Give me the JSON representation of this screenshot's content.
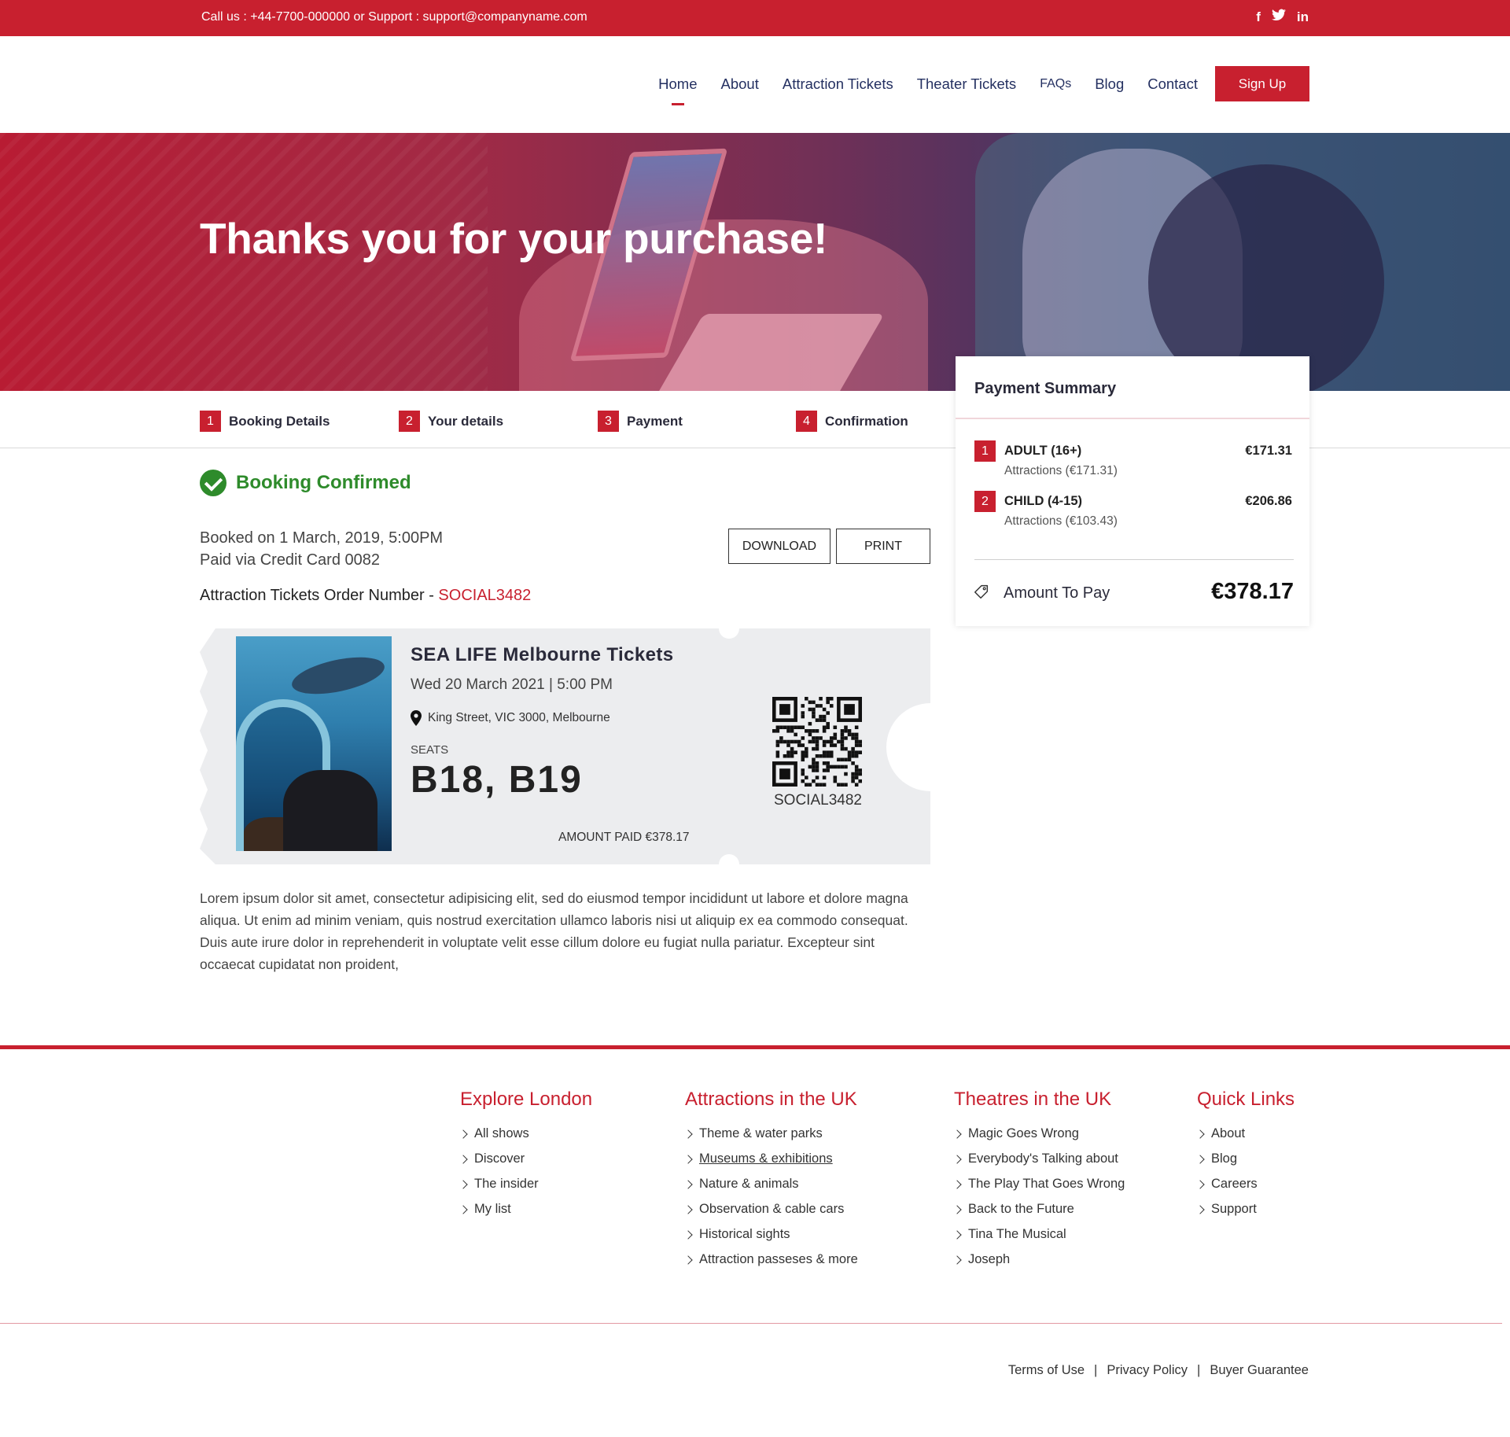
{
  "topbar": {
    "contact": "Call us : +44-7700-000000  or  Support : support@companyname.com",
    "social": [
      {
        "icon": "facebook-icon",
        "glyph": "f"
      },
      {
        "icon": "twitter-icon",
        "glyph": "🐦"
      },
      {
        "icon": "linkedin-icon",
        "glyph": "in"
      }
    ]
  },
  "nav": {
    "items": [
      "Home",
      "About",
      "Attraction Tickets",
      "Theater Tickets",
      "FAQs",
      "Blog",
      "Contact"
    ],
    "active": "Home",
    "signup": "Sign Up"
  },
  "hero": {
    "title": "Thanks you for your purchase!"
  },
  "steps": [
    {
      "num": "1",
      "label": "Booking Details"
    },
    {
      "num": "2",
      "label": "Your details"
    },
    {
      "num": "3",
      "label": "Payment"
    },
    {
      "num": "4",
      "label": "Confirmation"
    }
  ],
  "summary": {
    "title": "Payment Summary",
    "items": [
      {
        "num": "1",
        "name": "ADULT (16+)",
        "sub": "Attractions (€171.31)",
        "price": "€171.31"
      },
      {
        "num": "2",
        "name": "CHILD (4-15)",
        "sub": "Attractions (€103.43)",
        "price": "€206.86"
      }
    ],
    "amount_label": "Amount To Pay",
    "amount": "€378.17"
  },
  "booking": {
    "status": "Booking Confirmed",
    "booked_on": "Booked on 1 March, 2019, 5:00PM",
    "paid_via": "Paid via Credit Card 0082",
    "download": "DOWNLOAD",
    "print": "PRINT",
    "order_label": "Attraction Tickets Order Number - ",
    "order_code": "SOCIAL3482"
  },
  "ticket": {
    "title": "SEA LIFE Melbourne Tickets",
    "date": "Wed 20 March 2021 | 5:00 PM",
    "location": "King Street, VIC 3000, Melbourne",
    "seats_label": "SEATS",
    "seats": "B18, B19",
    "amount_paid": "AMOUNT PAID  €378.17",
    "code": "SOCIAL3482"
  },
  "lorem": "Lorem ipsum dolor sit amet, consectetur adipisicing elit, sed do eiusmod tempor incididunt ut labore et dolore magna aliqua. Ut enim ad minim veniam, quis nostrud exercitation ullamco laboris nisi ut aliquip ex ea commodo consequat. Duis aute irure dolor in reprehenderit in voluptate velit esse cillum dolore eu fugiat nulla pariatur. Excepteur sint occaecat cupidatat non proident,",
  "footer": {
    "columns": [
      {
        "title": "Explore London",
        "links": [
          "All shows",
          "Discover",
          "The insider",
          "My list"
        ]
      },
      {
        "title": "Attractions in the UK",
        "links": [
          "Theme & water parks",
          "Museums & exhibitions",
          "Nature & animals",
          "Observation & cable cars",
          "Historical sights",
          "Attraction passeses & more"
        ]
      },
      {
        "title": "Theatres in the UK",
        "links": [
          "Magic Goes Wrong",
          "Everybody's Talking about",
          "The Play That Goes Wrong",
          "Back to the Future",
          "Tina The Musical",
          "Joseph"
        ]
      },
      {
        "title": "Quick Links",
        "links": [
          "About",
          "Blog",
          "Careers",
          "Support"
        ]
      }
    ],
    "legal": [
      "Terms of Use",
      "Privacy Policy",
      "Buyer Guarantee"
    ]
  },
  "colors": {
    "accent": "#c8202f",
    "success": "#2e8b2b",
    "nav": "#243061"
  }
}
